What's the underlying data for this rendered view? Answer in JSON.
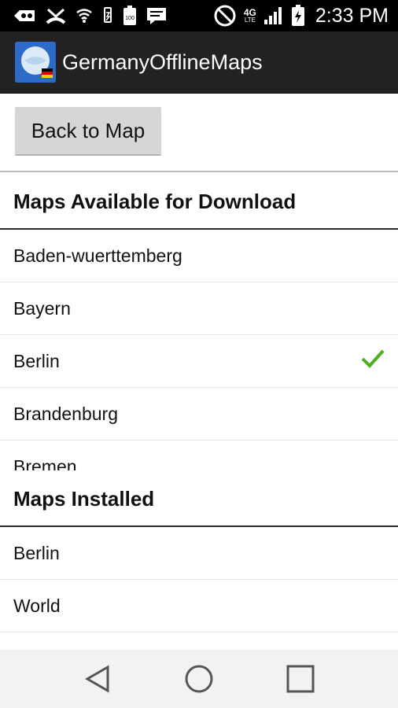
{
  "status_bar": {
    "time": "2:33 PM",
    "network": "4G",
    "network_sub": "LTE",
    "battery_label": "100",
    "icons": [
      "voicemail-icon",
      "missed-call-icon",
      "wifi-icon",
      "usb-icon",
      "battery-100-icon",
      "message-icon",
      "do-not-disturb-icon",
      "lte-data-icon",
      "signal-icon",
      "battery-charging-icon"
    ]
  },
  "app_bar": {
    "title": "GermanyOfflineMaps",
    "icon": "globe-app-icon"
  },
  "toolbar": {
    "back_label": "Back to Map"
  },
  "available": {
    "heading": "Maps Available for Download",
    "items": [
      {
        "label": "Baden-wuerttemberg",
        "checked": false
      },
      {
        "label": "Bayern",
        "checked": false
      },
      {
        "label": "Berlin",
        "checked": true
      },
      {
        "label": "Brandenburg",
        "checked": false
      },
      {
        "label": "Bremen",
        "checked": false
      }
    ]
  },
  "installed": {
    "heading": "Maps Installed",
    "items": [
      {
        "label": "Berlin"
      },
      {
        "label": "World"
      }
    ]
  },
  "colors": {
    "check": "#4caf1d",
    "status_bar": "#000000",
    "app_bar": "#222222",
    "nav_bar": "#f2f2f2"
  }
}
